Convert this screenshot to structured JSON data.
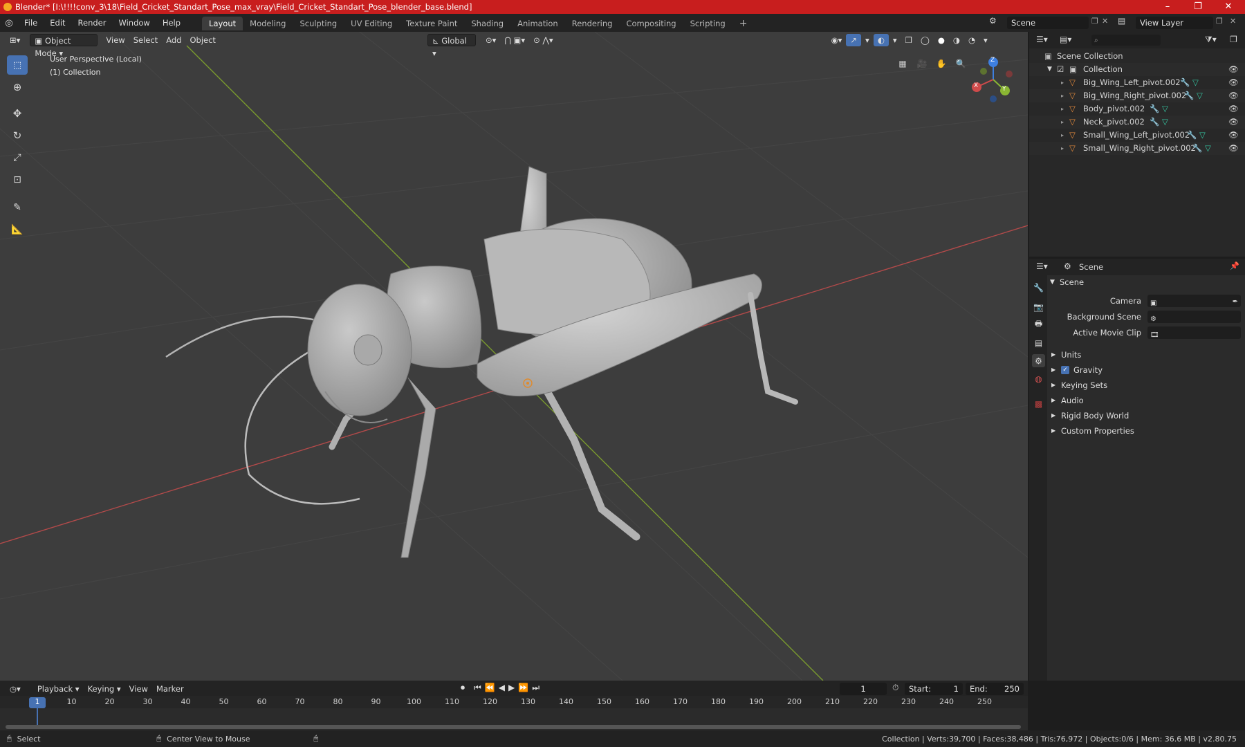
{
  "window": {
    "title": "Blender* [I:\\!!!!conv_3\\18\\Field_Cricket_Standart_Pose_max_vray\\Field_Cricket_Standart_Pose_blender_base.blend]",
    "minimize": "–",
    "restore": "❐",
    "close": "✕"
  },
  "menus": [
    "File",
    "Edit",
    "Render",
    "Window",
    "Help"
  ],
  "workspaces": [
    "Layout",
    "Modeling",
    "Sculpting",
    "UV Editing",
    "Texture Paint",
    "Shading",
    "Animation",
    "Rendering",
    "Compositing",
    "Scripting"
  ],
  "add_workspace": "+",
  "scene_selector": "Scene",
  "view_layer_selector": "View Layer",
  "viewport": {
    "mode": "Object Mode",
    "menus": [
      "View",
      "Select",
      "Add",
      "Object"
    ],
    "orientation": "Global",
    "perspective_label": "User Perspective (Local)",
    "collection_label": "(1) Collection",
    "gizmo": {
      "x": "X",
      "y": "Y",
      "z": "Z"
    }
  },
  "outliner": {
    "root": "Scene Collection",
    "collection": "Collection",
    "items": [
      "Big_Wing_Left_pivot.002",
      "Big_Wing_Right_pivot.002",
      "Body_pivot.002",
      "Neck_pivot.002",
      "Small_Wing_Left_pivot.002",
      "Small_Wing_Right_pivot.002"
    ]
  },
  "properties": {
    "header": "Scene",
    "section": "Scene",
    "fields": [
      {
        "label": "Camera"
      },
      {
        "label": "Background Scene"
      },
      {
        "label": "Active Movie Clip"
      }
    ],
    "panels": [
      "Units",
      "Gravity",
      "Keying Sets",
      "Audio",
      "Rigid Body World",
      "Custom Properties"
    ],
    "gravity_checked": true
  },
  "timeline": {
    "menus": [
      "Playback",
      "Keying",
      "View",
      "Marker"
    ],
    "current_frame": "1",
    "start_label": "Start:",
    "start_value": "1",
    "end_label": "End:",
    "end_value": "250",
    "ticks": [
      "1",
      "10",
      "20",
      "30",
      "40",
      "50",
      "60",
      "70",
      "80",
      "90",
      "100",
      "110",
      "120",
      "130",
      "140",
      "150",
      "160",
      "170",
      "180",
      "190",
      "200",
      "210",
      "220",
      "230",
      "240",
      "250"
    ]
  },
  "statusbar": {
    "select": "Select",
    "center_view": "Center View to Mouse",
    "stats": "Collection | Verts:39,700 | Faces:38,486 | Tris:76,972 | Objects:0/6 | Mem: 36.6 MB | v2.80.75"
  },
  "colors": {
    "titlebar": "#c81e1e",
    "accent": "#4772b3",
    "mesh_icon": "#e0883b",
    "modifier_icon": "#5aa5e6",
    "vertex_icon": "#35c4a0",
    "x_axis": "#d04b4b",
    "y_axis": "#8ab633",
    "z_axis": "#3e7fe0"
  }
}
